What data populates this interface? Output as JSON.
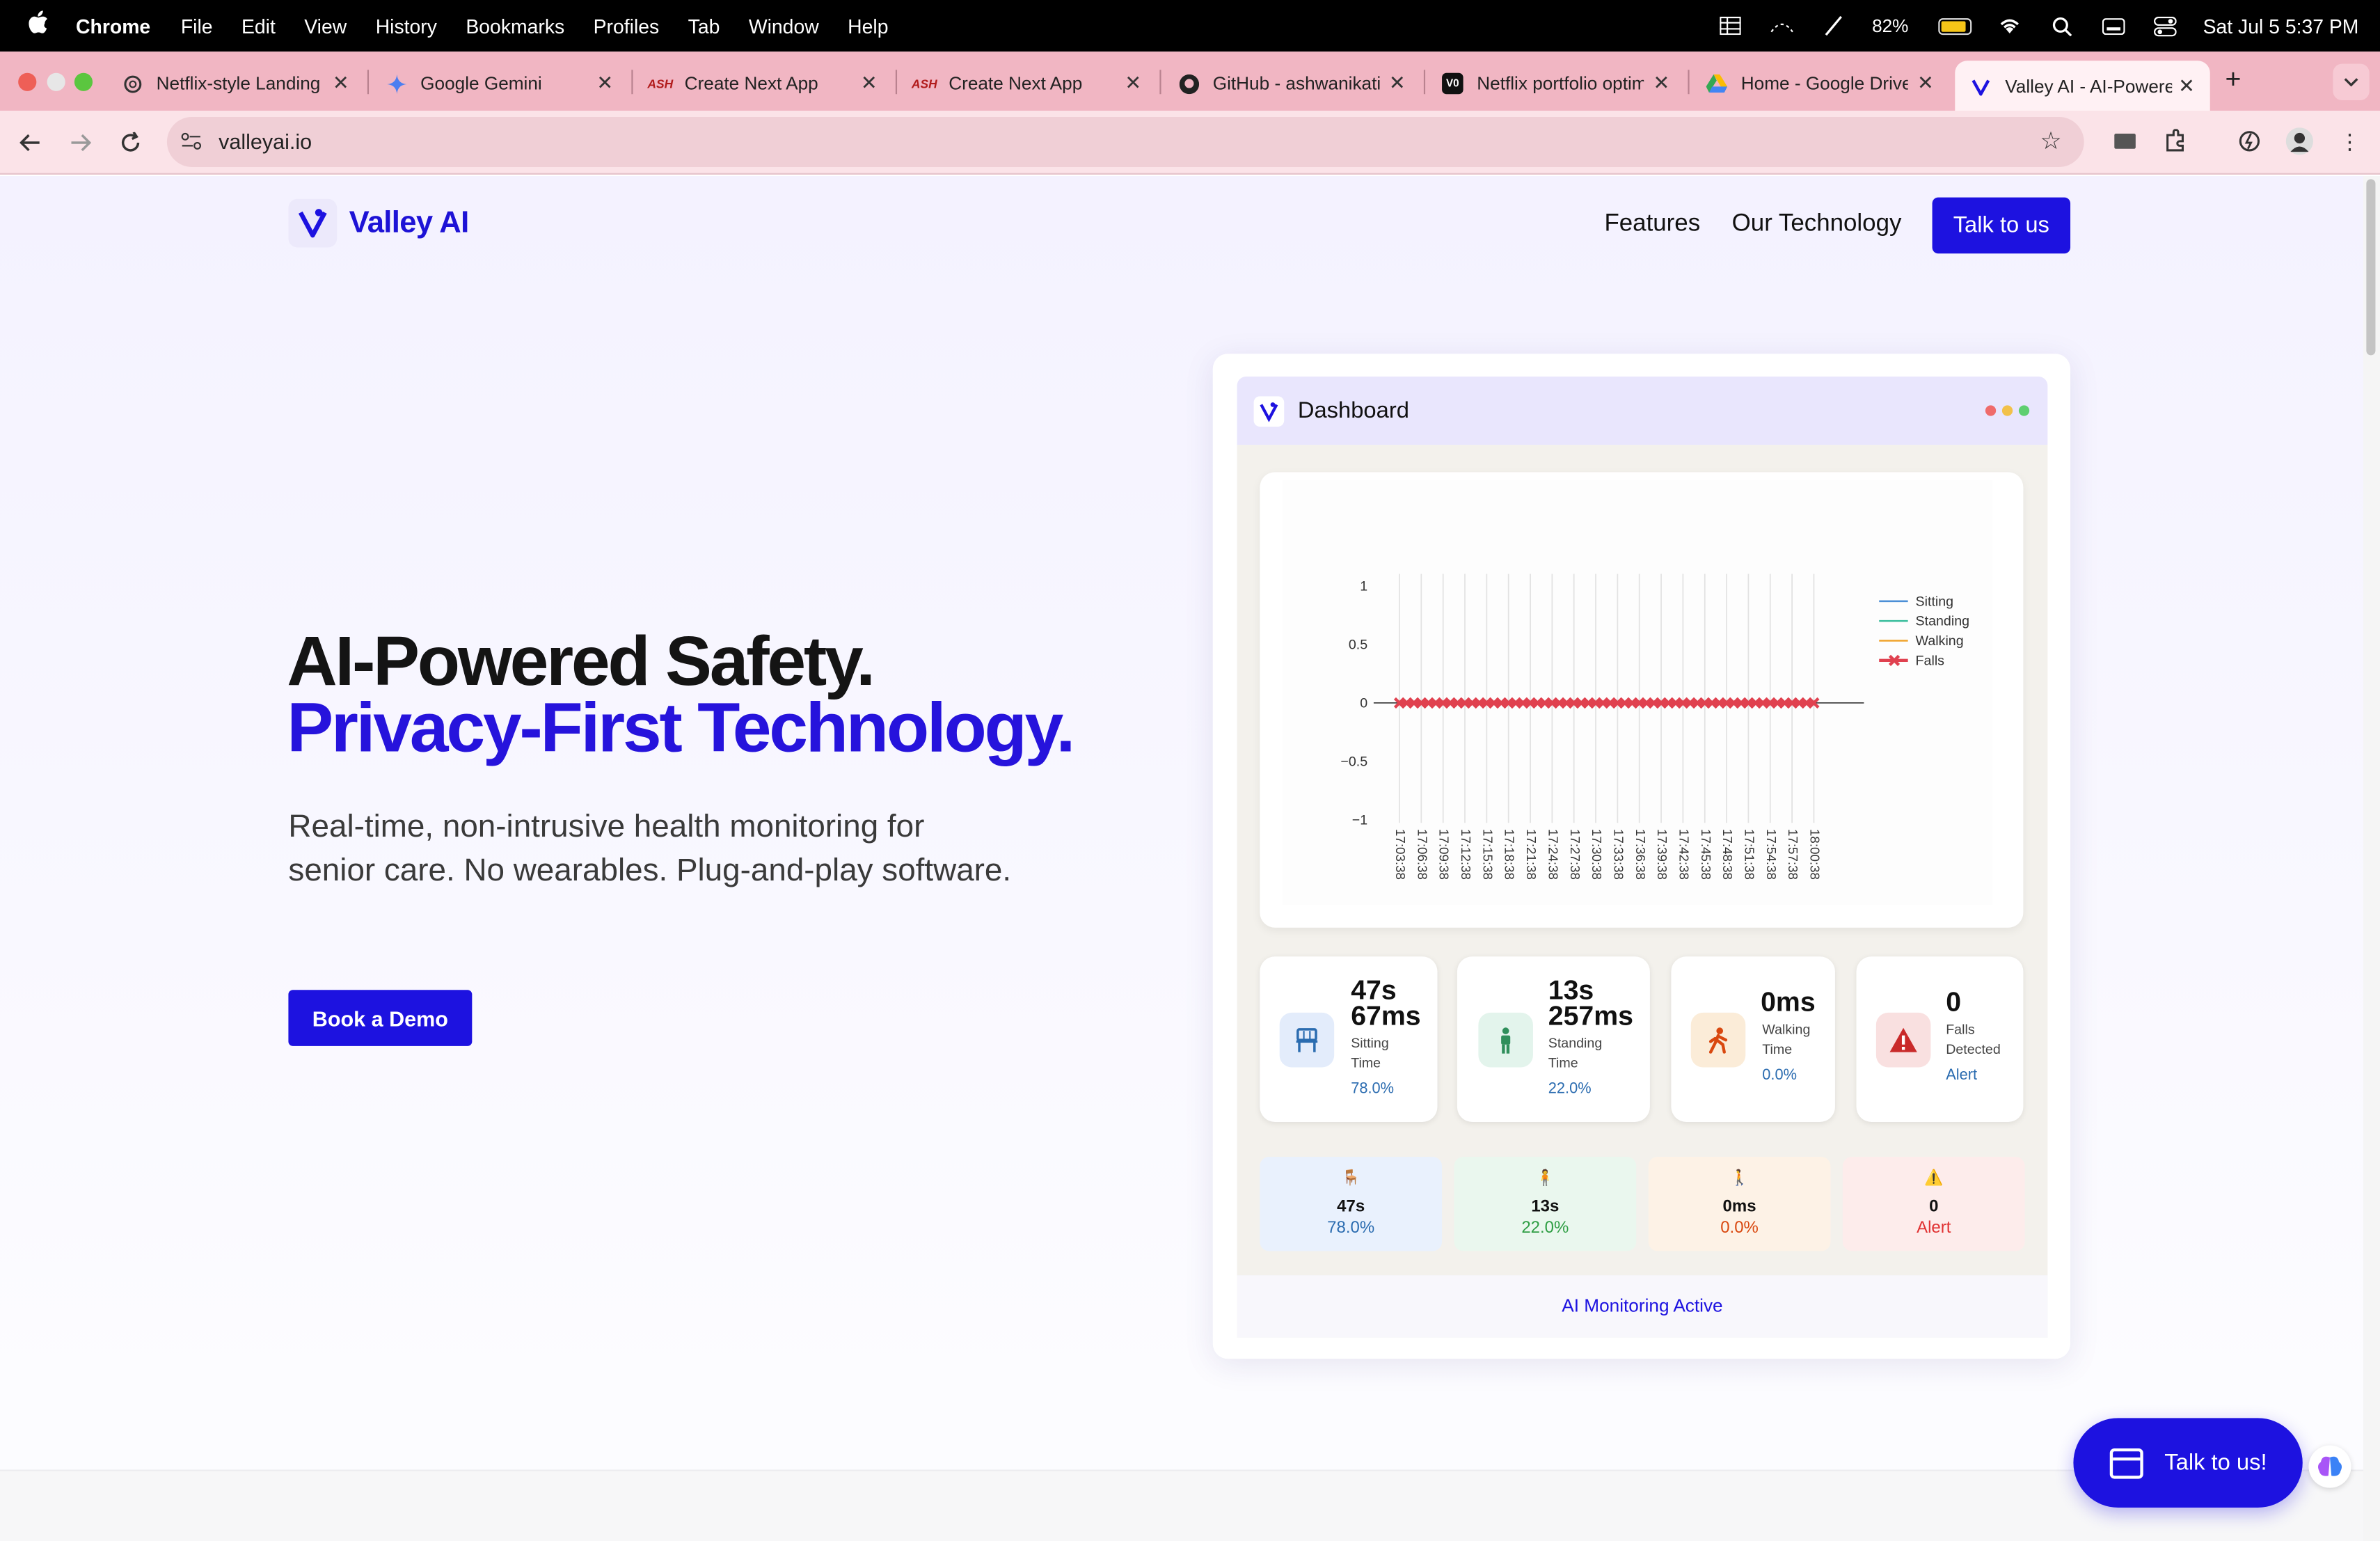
{
  "menubar": {
    "app": "Chrome",
    "items": [
      "File",
      "Edit",
      "View",
      "History",
      "Bookmarks",
      "Profiles",
      "Tab",
      "Window",
      "Help"
    ],
    "battery": "82%",
    "clock": "Sat Jul 5  5:37 PM"
  },
  "tabs": [
    {
      "title": "Netflix-style Landing",
      "icon": "openai-icon"
    },
    {
      "title": "Google Gemini",
      "icon": "gemini-icon"
    },
    {
      "title": "Create Next App",
      "icon": "ash-icon",
      "fav": "ASH"
    },
    {
      "title": "Create Next App",
      "icon": "ash-icon",
      "fav": "ASH"
    },
    {
      "title": "GitHub - ashwanikatiy",
      "icon": "github-icon"
    },
    {
      "title": "Netflix portfolio optim",
      "icon": "vercel-icon"
    },
    {
      "title": "Home - Google Drive",
      "icon": "drive-icon"
    },
    {
      "title": "Valley AI - AI-Powered",
      "icon": "valley-icon",
      "active": true
    }
  ],
  "toolbar": {
    "url": "valleyai.io"
  },
  "site": {
    "brand": "Valley AI",
    "nav": [
      "Features",
      "Our Technology"
    ],
    "cta_top": "Talk to us",
    "hero_line1": "AI-Powered Safety.",
    "hero_line2": "Privacy-First Technology.",
    "hero_sub": "Real-time, non-intrusive health monitoring for senior care. No wearables. Plug-and-play software.",
    "cta_demo": "Book a Demo",
    "float_cta": "Talk to us!",
    "colors": {
      "brand": "#1d12e0",
      "headline_accent": "#2613dc"
    }
  },
  "dashboard": {
    "title": "Dashboard",
    "stats": [
      {
        "big": "47s",
        "big2": "67ms",
        "label1": "Sitting",
        "label2": "Time",
        "pct": "78.0%",
        "icon": "chair-icon"
      },
      {
        "big": "13s",
        "big2": "257ms",
        "label1": "Standing",
        "label2": "Time",
        "pct": "22.0%",
        "icon": "standing-person-icon"
      },
      {
        "big": "0ms",
        "label1": "Walking",
        "label2": "Time",
        "pct": "0.0%",
        "icon": "walking-person-icon"
      },
      {
        "big": "0",
        "label1": "Falls",
        "label2": "Detected",
        "pct": "Alert",
        "icon": "warning-icon"
      }
    ],
    "mini": [
      {
        "icon": "🪑",
        "val": "47s",
        "pct": "78.0%",
        "color": "#2b6cb0",
        "bg": "#e9f1fd"
      },
      {
        "icon": "🧍",
        "val": "13s",
        "pct": "22.0%",
        "color": "#2f9e44",
        "bg": "#eaf7ee"
      },
      {
        "icon": "🚶",
        "val": "0ms",
        "pct": "0.0%",
        "color": "#d9480f",
        "bg": "#fdf2e6"
      },
      {
        "icon": "⚠️",
        "val": "0",
        "pct": "Alert",
        "color": "#e03131",
        "bg": "#fdeceb"
      }
    ],
    "monitor": "AI Monitoring Active"
  },
  "chart_data": {
    "type": "line",
    "title": "",
    "xlabel": "",
    "ylabel": "",
    "ylim": [
      -1,
      1
    ],
    "yticks": [
      "1",
      "0.5",
      "0",
      "−0.5",
      "−1"
    ],
    "x": [
      "17:03:38",
      "17:06:38",
      "17:09:38",
      "17:12:38",
      "17:15:38",
      "17:18:38",
      "17:21:38",
      "17:24:38",
      "17:27:38",
      "17:30:38",
      "17:33:38",
      "17:36:38",
      "17:39:38",
      "17:42:38",
      "17:45:38",
      "17:48:38",
      "17:51:38",
      "17:54:38",
      "17:57:38",
      "18:00:38"
    ],
    "series": [
      {
        "name": "Sitting",
        "color": "#4c8fd6",
        "values": []
      },
      {
        "name": "Standing",
        "color": "#3fbf9f",
        "values": []
      },
      {
        "name": "Walking",
        "color": "#f0a32b",
        "values": []
      },
      {
        "name": "Falls",
        "color": "#e0414f",
        "values": [
          0,
          0,
          0,
          0,
          0,
          0,
          0,
          0,
          0,
          0,
          0,
          0,
          0,
          0,
          0,
          0,
          0,
          0,
          0,
          0
        ]
      }
    ],
    "legend": "right",
    "grid": true
  }
}
